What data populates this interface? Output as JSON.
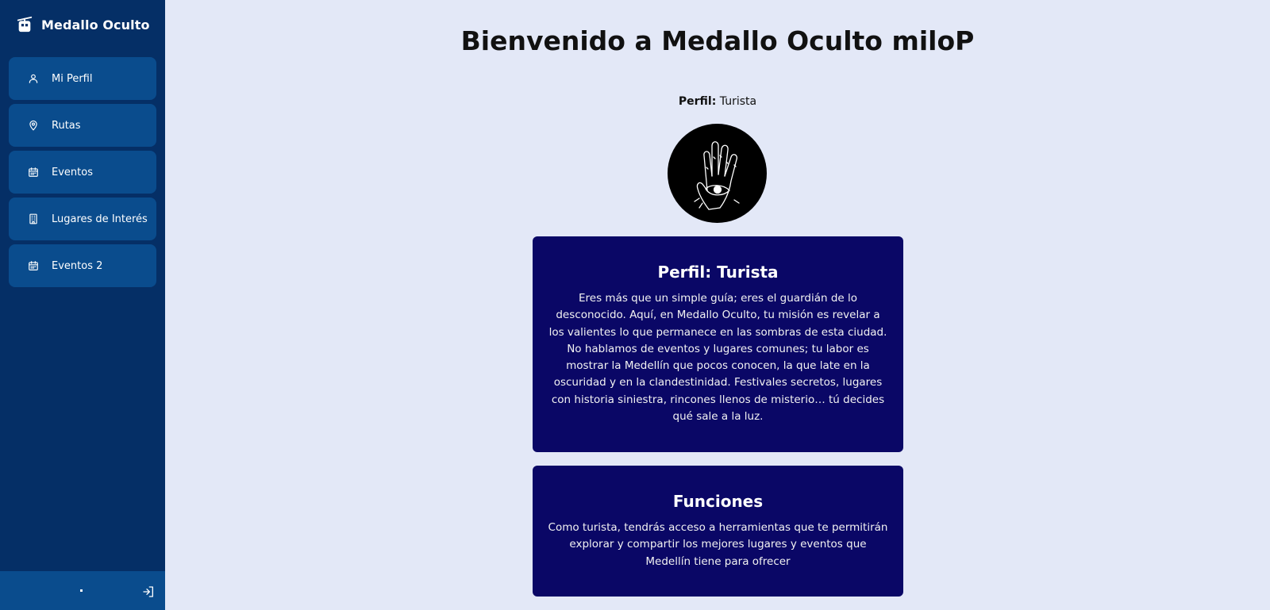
{
  "app": {
    "brand_name": "Medallo Oculto",
    "brand_icon": "cable-car-icon"
  },
  "sidebar": {
    "items": [
      {
        "label": "Mi Perfil",
        "icon": "user-icon"
      },
      {
        "label": "Rutas",
        "icon": "map-pin-icon"
      },
      {
        "label": "Eventos",
        "icon": "calendar-icon"
      },
      {
        "label": "Lugares de Interés",
        "icon": "building-icon"
      },
      {
        "label": "Eventos 2",
        "icon": "calendar-icon"
      }
    ],
    "footer": {
      "logout_icon": "logout-icon"
    }
  },
  "main": {
    "title": "Bienvenido a Medallo Oculto miloP",
    "profile_label": "Perfil:",
    "profile_value": "Turista",
    "avatar_icon": "hand-eye-avatar",
    "cards": [
      {
        "title": "Perfil: Turista",
        "body": "Eres más que un simple guía; eres el guardián de lo desconocido. Aquí, en Medallo Oculto, tu misión es revelar a los valientes lo que permanece en las sombras de esta ciudad. No hablamos de eventos y lugares comunes; tu labor es mostrar la Medellín que pocos conocen, la que late en la oscuridad y en la clandestinidad. Festivales secretos, lugares con historia siniestra, rincones llenos de misterio… tú decides qué sale a la luz."
      },
      {
        "title": "Funciones",
        "body": "Como turista, tendrás acceso a herramientas que te permitirán explorar y compartir los mejores lugares y eventos que Medellín tiene para ofrecer"
      }
    ]
  },
  "colors": {
    "sidebar_bg": "#052f66",
    "nav_item_bg": "#0a4c8d",
    "main_bg": "#e3e8f7",
    "card_bg": "#0a0766"
  }
}
